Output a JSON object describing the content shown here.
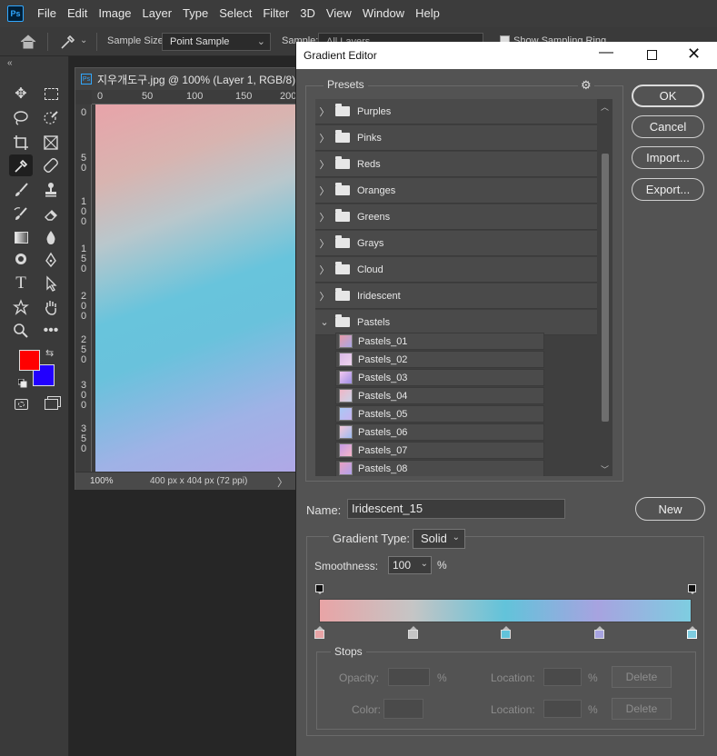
{
  "app": {
    "menu": [
      "File",
      "Edit",
      "Image",
      "Layer",
      "Type",
      "Select",
      "Filter",
      "3D",
      "View",
      "Window",
      "Help"
    ],
    "logo": "Ps"
  },
  "options_bar": {
    "sample_size_label": "Sample Size:",
    "sample_size_value": "Point Sample",
    "sample_label": "Sample:",
    "sample_value": "All Layers",
    "show_ring_label": "Show Sampling Ring"
  },
  "toolbar": {
    "collapse": "«",
    "foreground_color": "#ff0000",
    "background_color": "#2200ff"
  },
  "document": {
    "title": "지우개도구.jpg @ 100% (Layer 1, RGB/8) *",
    "ruler_top": [
      "0",
      "50",
      "100",
      "150",
      "200"
    ],
    "ruler_left": [
      "0",
      "5 0",
      "1 0 0",
      "1 5 0",
      "2 0 0",
      "2 5 0",
      "3 0 0",
      "3 5 0"
    ],
    "zoom": "100%",
    "size": "400 px x 404 px (72 ppi)",
    "status_arrow": "〉"
  },
  "dialog": {
    "title": "Gradient Editor",
    "presets_label": "Presets",
    "buttons": {
      "ok": "OK",
      "cancel": "Cancel",
      "import": "Import...",
      "export": "Export...",
      "new": "New"
    },
    "folders": [
      {
        "label": "Purples",
        "open": false
      },
      {
        "label": "Pinks",
        "open": false
      },
      {
        "label": "Reds",
        "open": false
      },
      {
        "label": "Oranges",
        "open": false
      },
      {
        "label": "Greens",
        "open": false
      },
      {
        "label": "Grays",
        "open": false
      },
      {
        "label": "Cloud",
        "open": false
      },
      {
        "label": "Iridescent",
        "open": false
      },
      {
        "label": "Pastels",
        "open": true
      }
    ],
    "gradients": [
      {
        "label": "Pastels_01",
        "from": "#e79aa8",
        "to": "#a8a7e6"
      },
      {
        "label": "Pastels_02",
        "from": "#d9b8e6",
        "to": "#eed4ee"
      },
      {
        "label": "Pastels_03",
        "from": "#f3c8f0",
        "to": "#9e8fe6"
      },
      {
        "label": "Pastels_04",
        "from": "#f0b7c6",
        "to": "#c9d2e8"
      },
      {
        "label": "Pastels_05",
        "from": "#a9c8f4",
        "to": "#c7b3f0"
      },
      {
        "label": "Pastels_06",
        "from": "#f6c6d8",
        "to": "#9cbcf2"
      },
      {
        "label": "Pastels_07",
        "from": "#c39be6",
        "to": "#f7b6c8"
      },
      {
        "label": "Pastels_08",
        "from": "#e8a0c2",
        "to": "#b1a2ec"
      }
    ],
    "name_label": "Name:",
    "name_value": "Iridescent_15",
    "gradient_type_label": "Gradient Type:",
    "gradient_type_value": "Solid",
    "smoothness_label": "Smoothness:",
    "smoothness_value": "100",
    "smoothness_unit": "%",
    "color_stops": [
      {
        "location": 0,
        "color": "#e8a4a6"
      },
      {
        "location": 25,
        "color": "#c5c5c5"
      },
      {
        "location": 50,
        "color": "#62c3da"
      },
      {
        "location": 75,
        "color": "#a7a3e0"
      },
      {
        "location": 100,
        "color": "#7ecde0"
      }
    ],
    "opacity_stops": [
      0,
      100
    ],
    "stops": {
      "label": "Stops",
      "opacity_label": "Opacity:",
      "opacity_unit": "%",
      "location_label": "Location:",
      "location_unit": "%",
      "color_label": "Color:",
      "delete_label": "Delete"
    }
  }
}
